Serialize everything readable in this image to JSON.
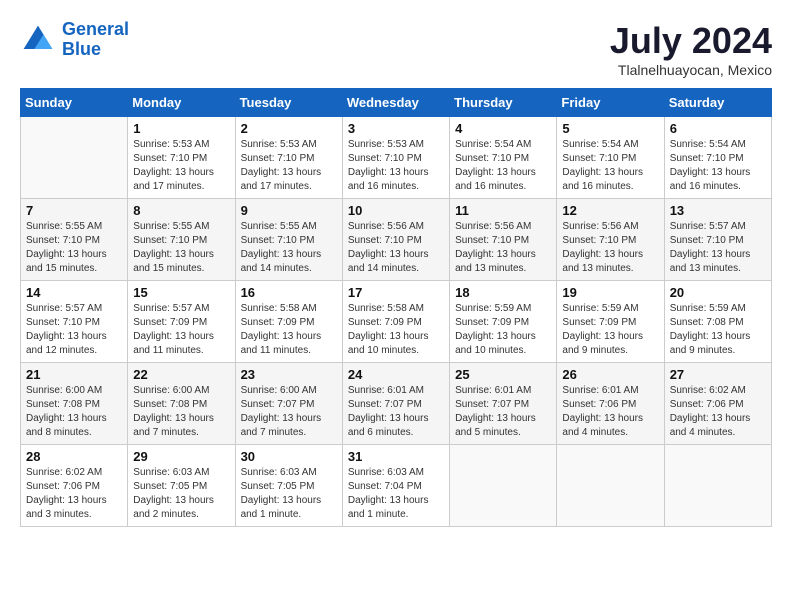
{
  "header": {
    "logo_line1": "General",
    "logo_line2": "Blue",
    "month": "July 2024",
    "location": "Tlalnelhuayocan, Mexico"
  },
  "days_of_week": [
    "Sunday",
    "Monday",
    "Tuesday",
    "Wednesday",
    "Thursday",
    "Friday",
    "Saturday"
  ],
  "weeks": [
    [
      {
        "day": "",
        "info": ""
      },
      {
        "day": "1",
        "info": "Sunrise: 5:53 AM\nSunset: 7:10 PM\nDaylight: 13 hours\nand 17 minutes."
      },
      {
        "day": "2",
        "info": "Sunrise: 5:53 AM\nSunset: 7:10 PM\nDaylight: 13 hours\nand 17 minutes."
      },
      {
        "day": "3",
        "info": "Sunrise: 5:53 AM\nSunset: 7:10 PM\nDaylight: 13 hours\nand 16 minutes."
      },
      {
        "day": "4",
        "info": "Sunrise: 5:54 AM\nSunset: 7:10 PM\nDaylight: 13 hours\nand 16 minutes."
      },
      {
        "day": "5",
        "info": "Sunrise: 5:54 AM\nSunset: 7:10 PM\nDaylight: 13 hours\nand 16 minutes."
      },
      {
        "day": "6",
        "info": "Sunrise: 5:54 AM\nSunset: 7:10 PM\nDaylight: 13 hours\nand 16 minutes."
      }
    ],
    [
      {
        "day": "7",
        "info": "Sunrise: 5:55 AM\nSunset: 7:10 PM\nDaylight: 13 hours\nand 15 minutes."
      },
      {
        "day": "8",
        "info": "Sunrise: 5:55 AM\nSunset: 7:10 PM\nDaylight: 13 hours\nand 15 minutes."
      },
      {
        "day": "9",
        "info": "Sunrise: 5:55 AM\nSunset: 7:10 PM\nDaylight: 13 hours\nand 14 minutes."
      },
      {
        "day": "10",
        "info": "Sunrise: 5:56 AM\nSunset: 7:10 PM\nDaylight: 13 hours\nand 14 minutes."
      },
      {
        "day": "11",
        "info": "Sunrise: 5:56 AM\nSunset: 7:10 PM\nDaylight: 13 hours\nand 13 minutes."
      },
      {
        "day": "12",
        "info": "Sunrise: 5:56 AM\nSunset: 7:10 PM\nDaylight: 13 hours\nand 13 minutes."
      },
      {
        "day": "13",
        "info": "Sunrise: 5:57 AM\nSunset: 7:10 PM\nDaylight: 13 hours\nand 13 minutes."
      }
    ],
    [
      {
        "day": "14",
        "info": "Sunrise: 5:57 AM\nSunset: 7:10 PM\nDaylight: 13 hours\nand 12 minutes."
      },
      {
        "day": "15",
        "info": "Sunrise: 5:57 AM\nSunset: 7:09 PM\nDaylight: 13 hours\nand 11 minutes."
      },
      {
        "day": "16",
        "info": "Sunrise: 5:58 AM\nSunset: 7:09 PM\nDaylight: 13 hours\nand 11 minutes."
      },
      {
        "day": "17",
        "info": "Sunrise: 5:58 AM\nSunset: 7:09 PM\nDaylight: 13 hours\nand 10 minutes."
      },
      {
        "day": "18",
        "info": "Sunrise: 5:59 AM\nSunset: 7:09 PM\nDaylight: 13 hours\nand 10 minutes."
      },
      {
        "day": "19",
        "info": "Sunrise: 5:59 AM\nSunset: 7:09 PM\nDaylight: 13 hours\nand 9 minutes."
      },
      {
        "day": "20",
        "info": "Sunrise: 5:59 AM\nSunset: 7:08 PM\nDaylight: 13 hours\nand 9 minutes."
      }
    ],
    [
      {
        "day": "21",
        "info": "Sunrise: 6:00 AM\nSunset: 7:08 PM\nDaylight: 13 hours\nand 8 minutes."
      },
      {
        "day": "22",
        "info": "Sunrise: 6:00 AM\nSunset: 7:08 PM\nDaylight: 13 hours\nand 7 minutes."
      },
      {
        "day": "23",
        "info": "Sunrise: 6:00 AM\nSunset: 7:07 PM\nDaylight: 13 hours\nand 7 minutes."
      },
      {
        "day": "24",
        "info": "Sunrise: 6:01 AM\nSunset: 7:07 PM\nDaylight: 13 hours\nand 6 minutes."
      },
      {
        "day": "25",
        "info": "Sunrise: 6:01 AM\nSunset: 7:07 PM\nDaylight: 13 hours\nand 5 minutes."
      },
      {
        "day": "26",
        "info": "Sunrise: 6:01 AM\nSunset: 7:06 PM\nDaylight: 13 hours\nand 4 minutes."
      },
      {
        "day": "27",
        "info": "Sunrise: 6:02 AM\nSunset: 7:06 PM\nDaylight: 13 hours\nand 4 minutes."
      }
    ],
    [
      {
        "day": "28",
        "info": "Sunrise: 6:02 AM\nSunset: 7:06 PM\nDaylight: 13 hours\nand 3 minutes."
      },
      {
        "day": "29",
        "info": "Sunrise: 6:03 AM\nSunset: 7:05 PM\nDaylight: 13 hours\nand 2 minutes."
      },
      {
        "day": "30",
        "info": "Sunrise: 6:03 AM\nSunset: 7:05 PM\nDaylight: 13 hours\nand 1 minute."
      },
      {
        "day": "31",
        "info": "Sunrise: 6:03 AM\nSunset: 7:04 PM\nDaylight: 13 hours\nand 1 minute."
      },
      {
        "day": "",
        "info": ""
      },
      {
        "day": "",
        "info": ""
      },
      {
        "day": "",
        "info": ""
      }
    ]
  ]
}
